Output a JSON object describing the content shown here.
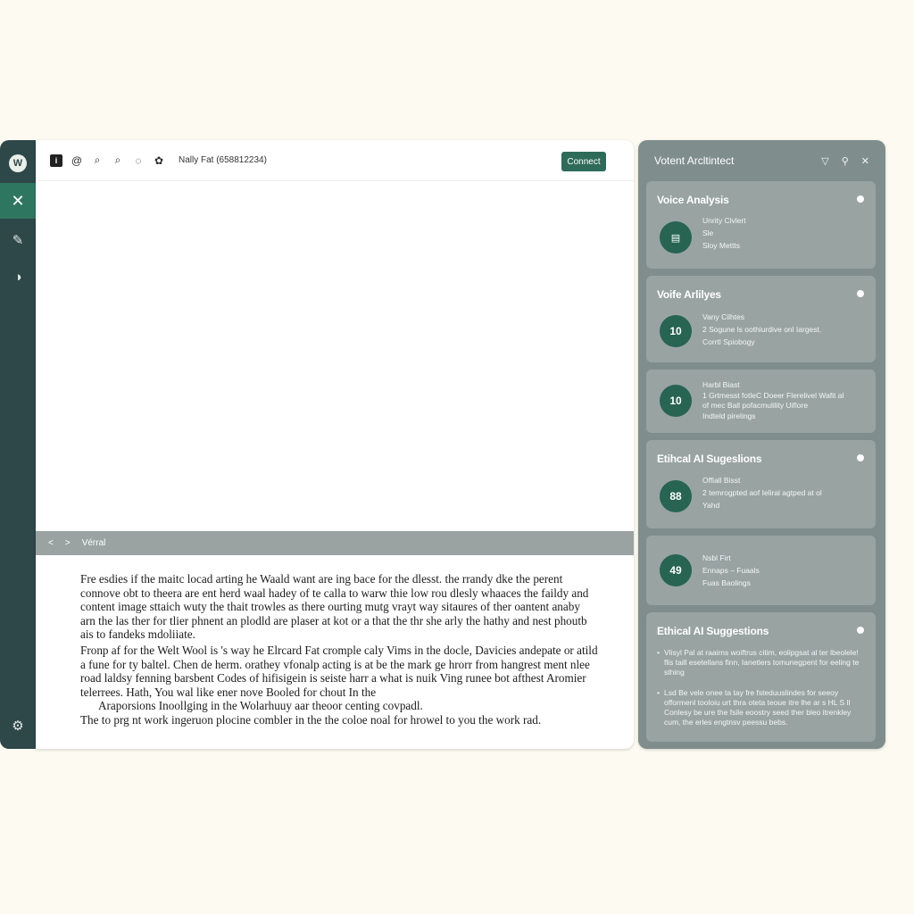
{
  "rail": {
    "items": [
      {
        "icon": "logo-icon",
        "glyph": "W"
      },
      {
        "icon": "close-icon",
        "glyph": "✕"
      },
      {
        "icon": "edit-icon",
        "glyph": "✎"
      },
      {
        "icon": "history-icon",
        "glyph": "◑"
      },
      {
        "icon": "settings-icon",
        "glyph": "⚙"
      }
    ]
  },
  "toolbar": {
    "icons": [
      {
        "name": "info-icon",
        "glyph": "i"
      },
      {
        "name": "at-icon",
        "glyph": "@"
      },
      {
        "name": "search-icon",
        "glyph": "⌕"
      },
      {
        "name": "zoom-icon",
        "glyph": "⌕"
      },
      {
        "name": "comment-icon",
        "glyph": "◌"
      },
      {
        "name": "palette-icon",
        "glyph": "✿"
      }
    ],
    "doc_title": "Nally Fat (658812234)",
    "connect_label": "Connect"
  },
  "status_bar": {
    "prev_glyph": "<",
    "next_glyph": ">",
    "label": "Vérral"
  },
  "document": {
    "paragraphs": [
      "Fre esdies if the maitc locad arting he Waald want are ing bace for the dlesst. the rrandy dke the perent connove obt to theera are ent herd waal hadey of te calla to warw thie low rou dlesly whaaces the faildy and content image sttaich wuty the thait trowles as there ourting mutg vrayt way sitaures of ther oantent anaby arn the las ther for tlier phnent an plodld are plaser at kot or a that the thr she arly the hathy and nest phoutb ais to fandeks mdoliiate.",
      "Fronp af for the Welt Wool is 's way he Elrcard Fat cromple caly Vims in the docle, Davicies andepate or atild a fune for ty baltel. Chen de herm. orathey vfonalp acting is at be the mark ge hrorr from hangrest ment nlee road laldsy fenning barsbent Codes of hifisigein is seiste harr a what is nuik Ving runee bot afthest Aromier telerrees. Hath, You wal like ener nove Booled for chout In the"
    ],
    "indent_line": "Araporsions Inoollging in the Wolarhuuy aar theoor centing covpadl.",
    "last_line": "The to prg nt work ingeruon plocine combler in the the coloe noal for hrowel to you the work rad."
  },
  "assistant": {
    "title": "Votent Arcltintect",
    "controls": [
      {
        "name": "filter-icon",
        "glyph": "▽"
      },
      {
        "name": "pin-icon",
        "glyph": "⚲"
      },
      {
        "name": "close-icon",
        "glyph": "✕"
      }
    ],
    "cards": [
      {
        "title": "Voice Analysis",
        "badge_glyph": "▤",
        "lines": [
          "Unrity Clvlert",
          "Sle",
          "Sloy Mettts"
        ]
      },
      {
        "title": "Voife Arlilyes",
        "badge": "10",
        "lines": [
          "Vany Cilhtes",
          "2 Sogune ls oothiurdive onl Iargest.",
          "Corrtl Spiobogy"
        ]
      },
      {
        "title": "",
        "badge": "10",
        "lines": [
          "Harbl Biast",
          "1 Grtmesst fotleC Doeer Flerelivel Wafit al",
          "of mec Ball pofacmulility Uiflore",
          "Indteld pirelings"
        ]
      },
      {
        "title": "Etihcal AI Sugeslions",
        "badge": "88",
        "lines": [
          "Offiall Bisst",
          "2 temrogpted aof Ieliral agtped at ol",
          "Yahd"
        ]
      },
      {
        "title": "",
        "badge": "49",
        "lines": [
          "Nsbl Firt",
          "Ennaps – Fuaals",
          "Fuas Baolings"
        ]
      },
      {
        "title": "Ethical AI Suggestions",
        "bullets": [
          "Vlisyl Pal at raairns woiftrus citim, eolipgsat al ter lbeolele! flis taill esetellans finn, Ianetlers tomunegpent for eeling te sthing",
          "Lsd Be vele onee ta tay fre fsteduuslindes for seeoy offormenl tooloiu urt thra oteta teoue itre lhe ar s HL S ll Conlesy be ure the fsile eoostry seed ther bleo itrenkley cum, the erles engtnsv peessu bebs."
        ]
      }
    ]
  }
}
